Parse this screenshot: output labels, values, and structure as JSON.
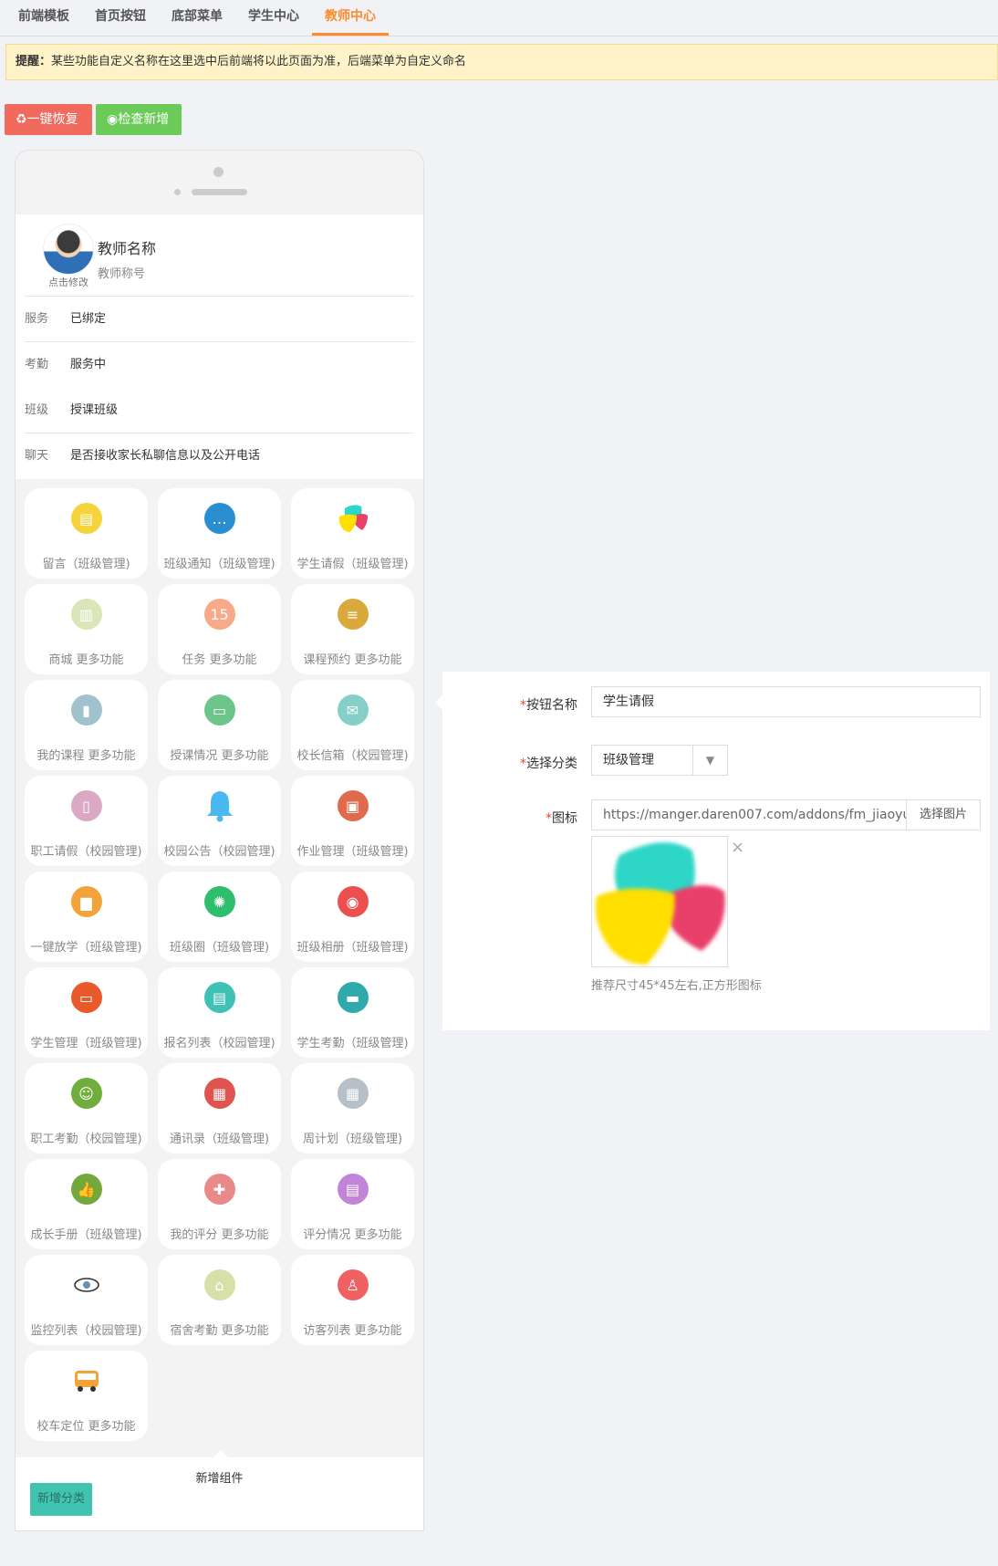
{
  "tabs": [
    {
      "label": "前端模板"
    },
    {
      "label": "首页按钮"
    },
    {
      "label": "底部菜单"
    },
    {
      "label": "学生中心"
    },
    {
      "label": "教师中心"
    }
  ],
  "notice": {
    "prefix": "提醒：",
    "text": "某些功能自定义名称在这里选中后前端将以此页面为准，后端菜单为自定义命名"
  },
  "actions": {
    "restore": "♻一键恢复",
    "check": "◉检查新增"
  },
  "profile": {
    "avatar_tip": "点击修改",
    "name": "教师名称",
    "title": "教师称号",
    "rows": [
      {
        "label": "服务",
        "value": "已绑定"
      },
      {
        "label": "考勤",
        "value": "服务中"
      },
      {
        "label": "班级",
        "value": "授课班级"
      },
      {
        "label": "聊天",
        "value": "是否接收家长私聊信息以及公开电话"
      }
    ]
  },
  "grid": [
    {
      "label": "留言（班级管理)",
      "icon": "message-board-icon",
      "color": "#f5d33c"
    },
    {
      "label": "班级通知（班级管理)",
      "icon": "chat-bubble-icon",
      "color": "#2a8fd1"
    },
    {
      "label": "学生请假（班级管理)",
      "icon": "tri-petal-icon",
      "color": "#ffffff"
    },
    {
      "label": "商城  更多功能",
      "icon": "books-icon",
      "color": "#d8e6b8"
    },
    {
      "label": "任务  更多功能",
      "icon": "calendar-icon",
      "color": "#f7a98a"
    },
    {
      "label": "课程预约  更多功能",
      "icon": "stack-icon",
      "color": "#d9a93c"
    },
    {
      "label": "我的课程  更多功能",
      "icon": "notebook-icon",
      "color": "#9fc2cc"
    },
    {
      "label": "授课情况  更多功能",
      "icon": "window-icon",
      "color": "#6cc58a"
    },
    {
      "label": "校长信箱（校园管理)",
      "icon": "mail-icon",
      "color": "#86cfc8"
    },
    {
      "label": "职工请假（校园管理)",
      "icon": "clipboard-icon",
      "color": "#d9a9c6"
    },
    {
      "label": "校园公告（校园管理)",
      "icon": "bell-icon",
      "color": "#4ab8f0"
    },
    {
      "label": "作业管理（班级管理)",
      "icon": "teacher-board-icon",
      "color": "#e06a4c"
    },
    {
      "label": "一键放学（班级管理)",
      "icon": "bus-icon",
      "color": "#f2a33a"
    },
    {
      "label": "班级圈（班级管理)",
      "icon": "aperture-icon",
      "color": "#2fbf6c"
    },
    {
      "label": "班级相册（班级管理)",
      "icon": "photo-icon",
      "color": "#ea5050"
    },
    {
      "label": "学生管理（班级管理)",
      "icon": "monitor-icon",
      "color": "#e85a2a"
    },
    {
      "label": "报名列表（校园管理)",
      "icon": "form-icon",
      "color": "#3fc1b5"
    },
    {
      "label": "学生考勤（班级管理)",
      "icon": "card-icon",
      "color": "#2fa9a9"
    },
    {
      "label": "职工考勤（校园管理)",
      "icon": "worker-icon",
      "color": "#6fae3c"
    },
    {
      "label": "通讯录（班级管理)",
      "icon": "contact-icon",
      "color": "#e05450"
    },
    {
      "label": "周计划（班级管理)",
      "icon": "week-plan-icon",
      "color": "#b6c0c8"
    },
    {
      "label": "成长手册（班级管理)",
      "icon": "thumbs-up-icon",
      "color": "#73a83a"
    },
    {
      "label": "我的评分  更多功能",
      "icon": "briefcase-icon",
      "color": "#e98a8a"
    },
    {
      "label": "评分情况  更多功能",
      "icon": "document-icon",
      "color": "#c184d8"
    },
    {
      "label": "监控列表（校园管理)",
      "icon": "eye-icon",
      "color": "#ffffff"
    },
    {
      "label": "宿舍考勤  更多功能",
      "icon": "house-icon",
      "color": "#d6e0a8"
    },
    {
      "label": "访客列表  更多功能",
      "icon": "user-icon",
      "color": "#f06262"
    },
    {
      "label": "校车定位  更多功能",
      "icon": "school-bus-icon",
      "color": "#ffffff"
    }
  ],
  "add_component": {
    "title": "新增组件",
    "add_category": "新增分类"
  },
  "form": {
    "name_label": "按钮名称",
    "name_value": "学生请假",
    "category_label": "选择分类",
    "category_value": "班级管理",
    "icon_label": "图标",
    "icon_url": "https://manger.daren007.com/addons/fm_jiaoyu",
    "pick_image": "选择图片",
    "close": "×",
    "hint": "推荐尺寸45*45左右,正方形图标",
    "required_mark": "*"
  },
  "colors": {
    "accent": "#ff8a2a",
    "red": "#f06a5e",
    "green": "#6bcb58",
    "teal": "#40c4b0"
  }
}
